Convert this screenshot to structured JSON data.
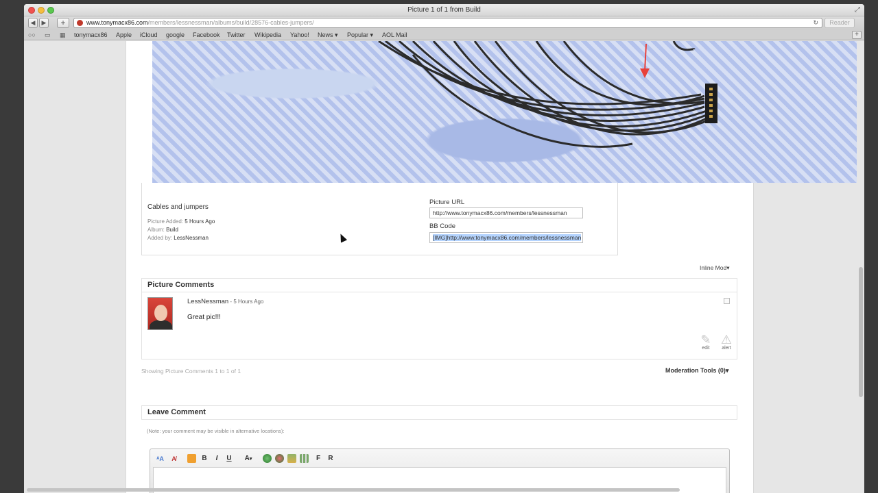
{
  "window": {
    "title": "Picture 1 of 1 from Build"
  },
  "toolbar": {
    "url_host": "www.tonymacx86.com",
    "url_path": "/members/lessnessman/albums/build/28576-cables-jumpers/",
    "reader_label": "Reader"
  },
  "bookmarks": [
    "tonymacx86",
    "Apple",
    "iCloud",
    "google",
    "Facebook",
    "Twitter",
    "Wikipedia",
    "Yahoo!",
    "News ▾",
    "Popular ▾",
    "AOL Mail"
  ],
  "picture": {
    "title": "Cables and jumpers",
    "added_label": "Picture Added:",
    "added_value": "5 Hours Ago",
    "album_label": "Album:",
    "album_value": "Build",
    "addedby_label": "Added by:",
    "addedby_value": "LessNessman",
    "url_label": "Picture URL",
    "url_value": "http://www.tonymacx86.com/members/lessnessman",
    "bbcode_label": "BB Code",
    "bbcode_value": "[IMG]http://www.tonymacx86.com/members/lessnessman"
  },
  "inline_mod": "Inline Mod▾",
  "comments": {
    "heading": "Picture Comments",
    "items": [
      {
        "author": "LessNessman",
        "sep": " - ",
        "time": "5 Hours Ago",
        "text": "Great pic!!!"
      }
    ],
    "edit_label": "edit",
    "alert_label": "alert",
    "showing": "Showing Picture Comments 1 to 1 of 1",
    "moderation": "Moderation Tools (0)▾"
  },
  "leave_comment": {
    "heading": "Leave Comment",
    "note": "(Note: your comment may be visible in alternative locations):",
    "toolbar": [
      "B",
      "I",
      "U",
      "A",
      "F",
      "R"
    ]
  },
  "colors": {
    "accent": "#b5d4fe",
    "photo_blue": "#b3c2ec",
    "arrow_red": "#e8403a"
  }
}
